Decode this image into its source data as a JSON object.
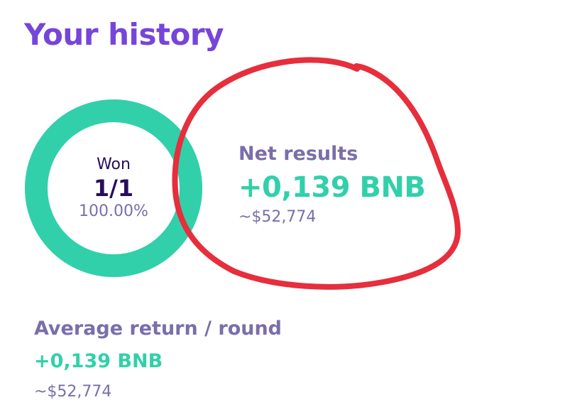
{
  "title": "Your history",
  "colors": {
    "title": "#7645d9",
    "text_dark": "#280d5f",
    "text_muted": "#7a6eaa",
    "success": "#31d0aa",
    "annotation": "#e62e3c"
  },
  "summary": {
    "won_label": "Won",
    "won_count": "1/1",
    "won_percent": "100.00%",
    "win_fraction": 1.0
  },
  "net_results": {
    "label": "Net results",
    "value": "+0,139 BNB",
    "usd": "~$52,774"
  },
  "average_return": {
    "label": "Average return / round",
    "value": "+0,139 BNB",
    "usd": "~$52,774"
  }
}
